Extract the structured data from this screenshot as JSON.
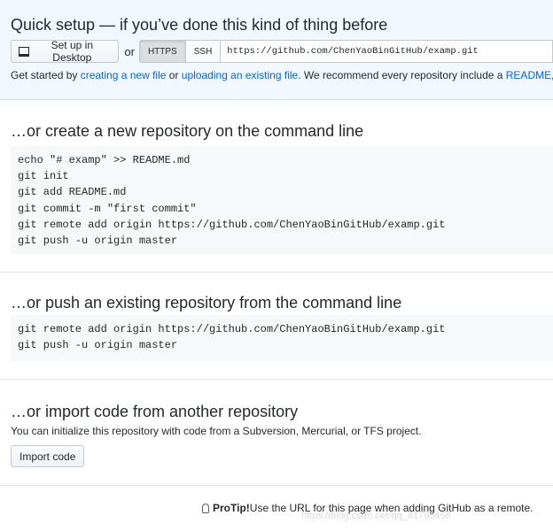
{
  "quick_setup": {
    "title": "Quick setup — if you’ve done this kind of thing before",
    "desktop_button": "Set up in Desktop",
    "or": "or",
    "https_label": "HTTPS",
    "ssh_label": "SSH",
    "clone_url": "https://github.com/ChenYaoBinGitHub/examp.git",
    "get_started_prefix": "Get started by ",
    "creating_link": "creating a new file",
    "or_word": " or ",
    "uploading_link": "uploading an existing file",
    "recommend_text": ". We recommend every repository include a ",
    "readme_link": "README",
    "trailing": ", L"
  },
  "create_new": {
    "title": "…or create a new repository on the command line",
    "lines": [
      "echo \"# examp\" >> README.md",
      "git init",
      "git add README.md",
      "git commit -m \"first commit\"",
      "git remote add origin https://github.com/ChenYaoBinGitHub/examp.git",
      "git push -u origin master"
    ]
  },
  "push_existing": {
    "title": "…or push an existing repository from the command line",
    "lines": [
      "git remote add origin https://github.com/ChenYaoBinGitHub/examp.git",
      "git push -u origin master"
    ]
  },
  "import_code": {
    "title": "…or import code from another repository",
    "description": "You can initialize this repository with code from a Subversion, Mercurial, or TFS project.",
    "button": "Import code"
  },
  "protip": {
    "label": "ProTip!",
    "text": " Use the URL for this page when adding GitHub as a remote."
  },
  "watermark": "https://blog.csdn.net/qq_41795456",
  "icons": {
    "desktop": "desktop-icon",
    "protip": "light-bulb-icon"
  }
}
